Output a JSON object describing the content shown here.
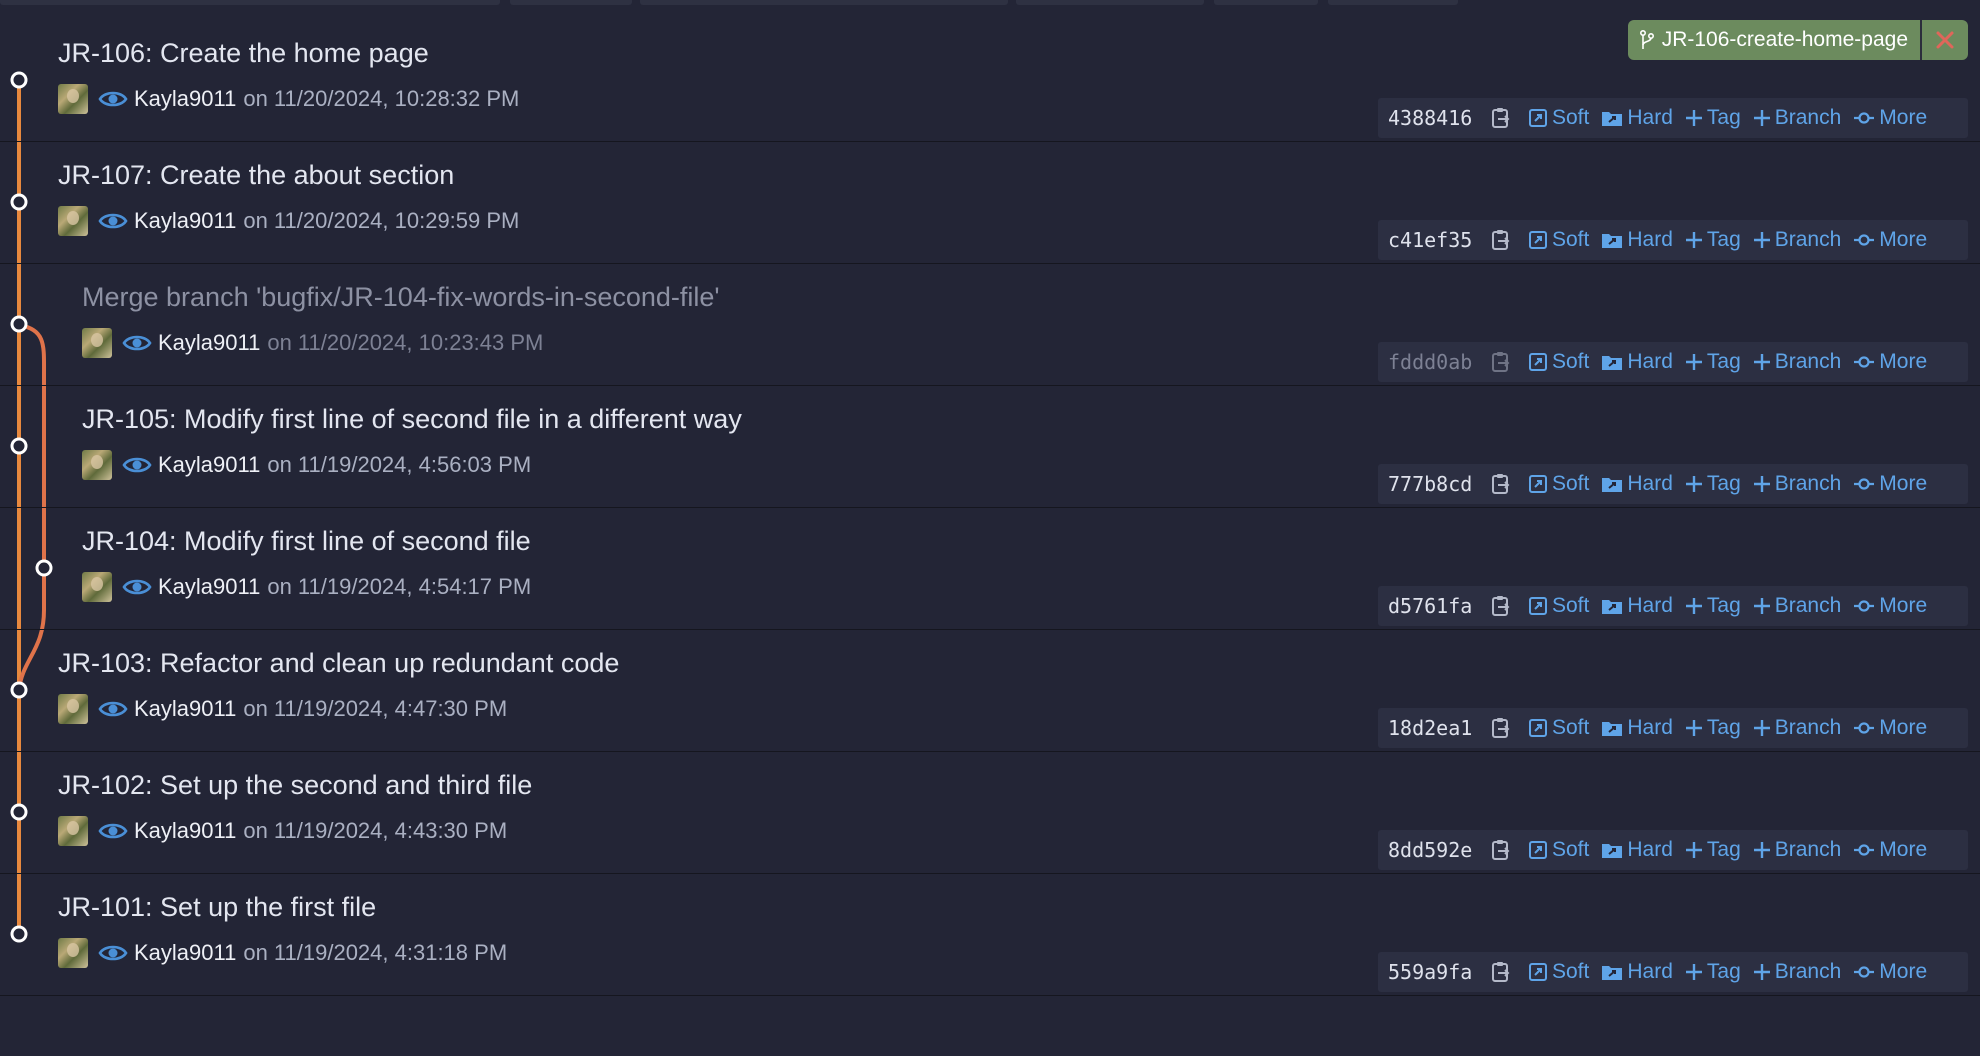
{
  "branch_tag": {
    "name": "JR-106-create-home-page"
  },
  "actions": {
    "soft": "Soft",
    "hard": "Hard",
    "tag": "Tag",
    "branch": "Branch",
    "more": "More"
  },
  "colors": {
    "main_lane": "#e8893e",
    "merge_lane": "#e0734a",
    "link": "#5fa4e8",
    "branch_tag": "#6c8b5e",
    "close_x": "#e0665a"
  },
  "commits": [
    {
      "title": "JR-106: Create the home page",
      "author": "Kayla9011",
      "date": "on 11/20/2024, 10:28:32 PM",
      "hash": "4388416"
    },
    {
      "title": "JR-107: Create the about section",
      "author": "Kayla9011",
      "date": "on 11/20/2024, 10:29:59 PM",
      "hash": "c41ef35"
    },
    {
      "title": "Merge branch 'bugfix/JR-104-fix-words-in-second-file'",
      "author": "Kayla9011",
      "date": "on 11/20/2024, 10:23:43 PM",
      "hash": "fddd0ab"
    },
    {
      "title": "JR-105: Modify first line of second file in a different way",
      "author": "Kayla9011",
      "date": "on 11/19/2024, 4:56:03 PM",
      "hash": "777b8cd"
    },
    {
      "title": "JR-104: Modify first line of second file",
      "author": "Kayla9011",
      "date": "on 11/19/2024, 4:54:17 PM",
      "hash": "d5761fa"
    },
    {
      "title": "JR-103: Refactor and clean up redundant code",
      "author": "Kayla9011",
      "date": "on 11/19/2024, 4:47:30 PM",
      "hash": "18d2ea1"
    },
    {
      "title": "JR-102: Set up the second and third file",
      "author": "Kayla9011",
      "date": "on 11/19/2024, 4:43:30 PM",
      "hash": "8dd592e"
    },
    {
      "title": "JR-101: Set up the first file",
      "author": "Kayla9011",
      "date": "on 11/19/2024, 4:31:18 PM",
      "hash": "559a9fa"
    }
  ]
}
